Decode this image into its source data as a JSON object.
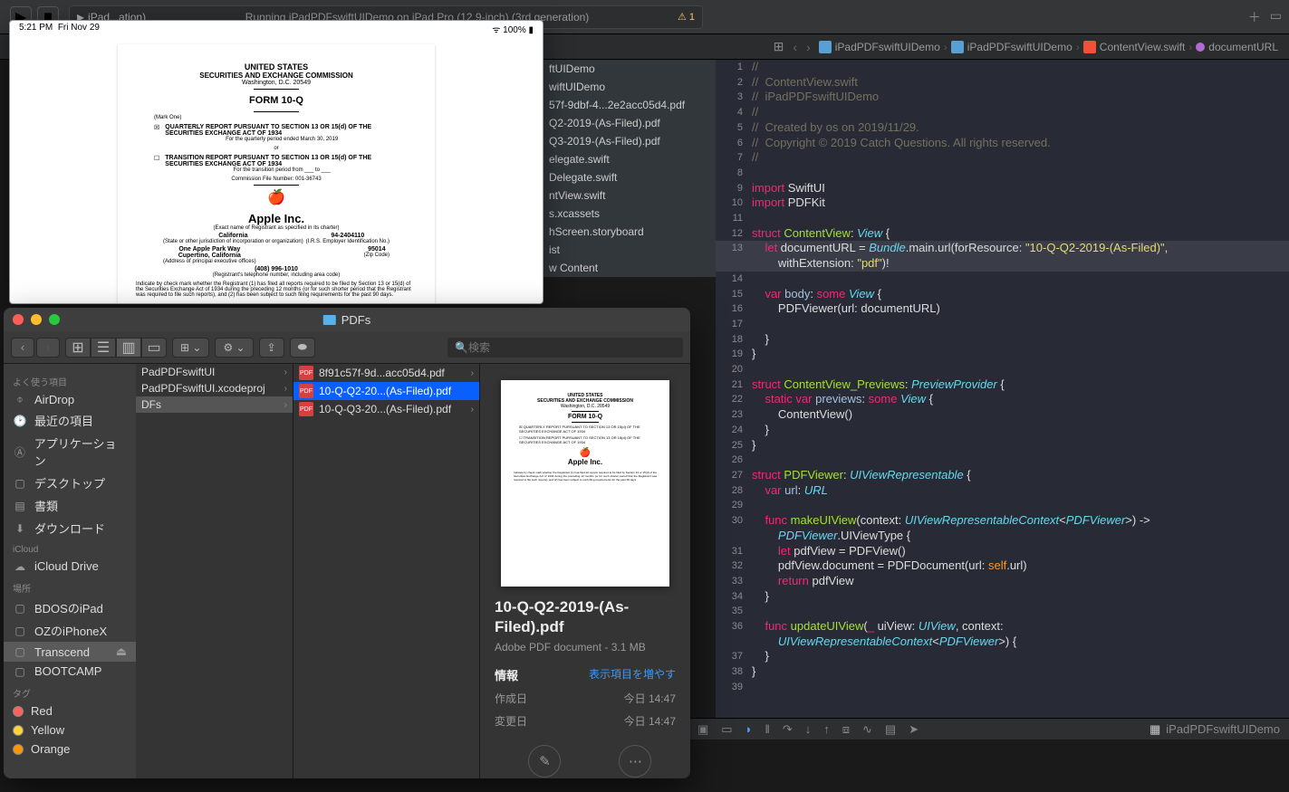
{
  "xcode": {
    "scheme": "iPad...ation)",
    "status": "Running iPadPDFswiftUIDemo on iPad Pro (12.9-inch) (3rd generation)",
    "warnings": "1",
    "breadcrumb": {
      "items": [
        "iPadPDFswiftUIDemo",
        "iPadPDFswiftUIDemo",
        "ContentView.swift",
        "documentURL"
      ]
    },
    "navigator": [
      "ftUIDemo",
      "wiftUIDemo",
      "57f-9dbf-4...2e2acc05d4.pdf",
      "Q2-2019-(As-Filed).pdf",
      "Q3-2019-(As-Filed).pdf",
      "elegate.swift",
      "Delegate.swift",
      "ntView.swift",
      "s.xcassets",
      "hScreen.storyboard",
      "ist",
      "w Content"
    ],
    "bottomApp": "iPadPDFswiftUIDemo",
    "code": {
      "lines": [
        {
          "n": 1,
          "t": "//",
          "c": "cmt"
        },
        {
          "n": 2,
          "t": "//  ContentView.swift",
          "c": "cmt"
        },
        {
          "n": 3,
          "t": "//  iPadPDFswiftUIDemo",
          "c": "cmt"
        },
        {
          "n": 4,
          "t": "//",
          "c": "cmt"
        },
        {
          "n": 5,
          "t": "//  Created by os on 2019/11/29.",
          "c": "cmt"
        },
        {
          "n": 6,
          "t": "//  Copyright © 2019 Catch Questions. All rights reserved.",
          "c": "cmt"
        },
        {
          "n": 7,
          "t": "//",
          "c": "cmt"
        },
        {
          "n": 8,
          "t": ""
        },
        {
          "n": 9,
          "html": "<span class='kw'>import</span> SwiftUI"
        },
        {
          "n": 10,
          "html": "<span class='kw'>import</span> PDFKit"
        },
        {
          "n": 11,
          "t": ""
        },
        {
          "n": 12,
          "html": "<span class='kw'>struct</span> <span class='fn'>ContentView</span>: <span class='type'>View</span> {"
        },
        {
          "n": 13,
          "hl": true,
          "html": "    <span class='kw'>let</span> documentURL = <span class='type'>Bundle</span>.main.url(forResource: <span class='str'>\"10-Q-Q2-2019-(As-Filed)\"</span>,\n        withExtension: <span class='str'>\"pdf\"</span>)!"
        },
        {
          "n": 14,
          "t": ""
        },
        {
          "n": 15,
          "html": "    <span class='kw'>var</span> <span class='ident'>body</span>: <span class='kw'>some</span> <span class='type'>View</span> {"
        },
        {
          "n": 16,
          "html": "        PDFViewer(url: documentURL)"
        },
        {
          "n": 17,
          "t": ""
        },
        {
          "n": 18,
          "t": "    }"
        },
        {
          "n": 19,
          "t": "}"
        },
        {
          "n": 20,
          "t": ""
        },
        {
          "n": 21,
          "html": "<span class='kw'>struct</span> <span class='fn'>ContentView_Previews</span>: <span class='type'>PreviewProvider</span> {"
        },
        {
          "n": 22,
          "html": "    <span class='kw'>static</span> <span class='kw'>var</span> <span class='ident'>previews</span>: <span class='kw'>some</span> <span class='type'>View</span> {"
        },
        {
          "n": 23,
          "html": "        ContentView()"
        },
        {
          "n": 24,
          "t": "    }"
        },
        {
          "n": 25,
          "t": "}"
        },
        {
          "n": 26,
          "t": ""
        },
        {
          "n": 27,
          "html": "<span class='kw'>struct</span> <span class='fn'>PDFViewer</span>: <span class='type'>UIViewRepresentable</span> {"
        },
        {
          "n": 28,
          "html": "    <span class='kw'>var</span> <span class='ident'>url</span>: <span class='type'>URL</span>"
        },
        {
          "n": 29,
          "t": ""
        },
        {
          "n": 30,
          "html": "    <span class='kw'>func</span> <span class='fn'>makeUIView</span>(context: <span class='type'>UIViewRepresentableContext</span>&lt;<span class='type'>PDFViewer</span>&gt;) -&gt;\n        <span class='type'>PDFViewer</span>.UIViewType {"
        },
        {
          "n": 31,
          "html": "        <span class='kw'>let</span> pdfView = PDFView()"
        },
        {
          "n": 32,
          "html": "        pdfView.document = PDFDocument(url: <span class='self'>self</span>.url)"
        },
        {
          "n": 33,
          "html": "        <span class='kw'>return</span> pdfView"
        },
        {
          "n": 34,
          "t": "    }"
        },
        {
          "n": 35,
          "t": ""
        },
        {
          "n": 36,
          "html": "    <span class='kw'>func</span> <span class='fn'>updateUIView</span>(<span class='kw'>_</span> uiView: <span class='type'>UIView</span>, context:\n        <span class='type'>UIViewRepresentableContext</span>&lt;<span class='type'>PDFViewer</span>&gt;) {"
        },
        {
          "n": 37,
          "t": "    }"
        },
        {
          "n": 38,
          "t": "}"
        },
        {
          "n": 39,
          "t": ""
        }
      ]
    }
  },
  "simulator": {
    "status": {
      "time": "5:21 PM",
      "date": "Fri Nov 29",
      "battery": "100%"
    },
    "pdf": {
      "h1": "UNITED STATES",
      "h2": "SECURITIES AND EXCHANGE COMMISSION",
      "loc": "Washington, D.C. 20549",
      "form": "FORM 10-Q",
      "mark": "(Mark One)",
      "sec1": "QUARTERLY REPORT PURSUANT TO SECTION 13 OR 15(d) OF THE SECURITIES EXCHANGE ACT OF 1934",
      "sec1b": "For the quarterly period ended March 30, 2019",
      "sec2": "TRANSITION REPORT PURSUANT TO SECTION 13 OR 15(d) OF THE SECURITIES EXCHANGE ACT OF 1934",
      "sec2b": "For the transition period from ___ to ___",
      "file": "Commission File Number: 001-36743",
      "company": "Apple Inc.",
      "reg": "(Exact name of Registrant as specified in its charter)",
      "state": "California",
      "state2": "(State or other jurisdiction of incorporation or organization)",
      "ein": "94-2404110",
      "ein2": "(I.R.S. Employer Identification No.)",
      "addr1": "One Apple Park Way",
      "addr2": "Cupertino, California",
      "addr3": "(Address of principal executive offices)",
      "zip": "95014",
      "zip2": "(Zip Code)",
      "phone": "(408) 996-1010",
      "phone2": "(Registrant's telephone number, including area code)",
      "indicate": "Indicate by check mark whether the Registrant (1) has filed all reports required to be filed by Section 13 or 15(d) of the Securities Exchange Act of 1934 during the preceding 12 months (or for such shorter period that the Registrant was required to file such reports), and (2) has been subject to such filing requirements for the past 90 days."
    }
  },
  "finder": {
    "title": "PDFs",
    "search_placeholder": "検索",
    "sidebar": {
      "headers": {
        "favorites": "よく使う項目",
        "icloud": "iCloud",
        "locations": "場所",
        "tags": "タグ"
      },
      "favorites": [
        "AirDrop",
        "最近の項目",
        "アプリケーション",
        "デスクトップ",
        "書類",
        "ダウンロード"
      ],
      "icloud": [
        "iCloud Drive"
      ],
      "locations": [
        "BDOSのiPad",
        "OZのiPhoneX",
        "Transcend",
        "BOOTCAMP"
      ],
      "tags": [
        "Red",
        "Yellow",
        "Orange"
      ]
    },
    "col1": [
      "PadPDFswiftUI",
      "PadPDFswiftUI.xcodeproj",
      "DFs"
    ],
    "col2": [
      "8f91c57f-9d...acc05d4.pdf",
      "10-Q-Q2-20...(As-Filed).pdf",
      "10-Q-Q3-20...(As-Filed).pdf"
    ],
    "preview": {
      "name": "10-Q-Q2-2019-(As-Filed).pdf",
      "subtitle": "Adobe PDF document - 3.1 MB",
      "info_label": "情報",
      "show_more": "表示項目を増やす",
      "created_label": "作成日",
      "created_val": "今日 14:47",
      "modified_label": "変更日",
      "modified_val": "今日 14:47",
      "markup": "マークアップ",
      "other": "その他..."
    }
  }
}
